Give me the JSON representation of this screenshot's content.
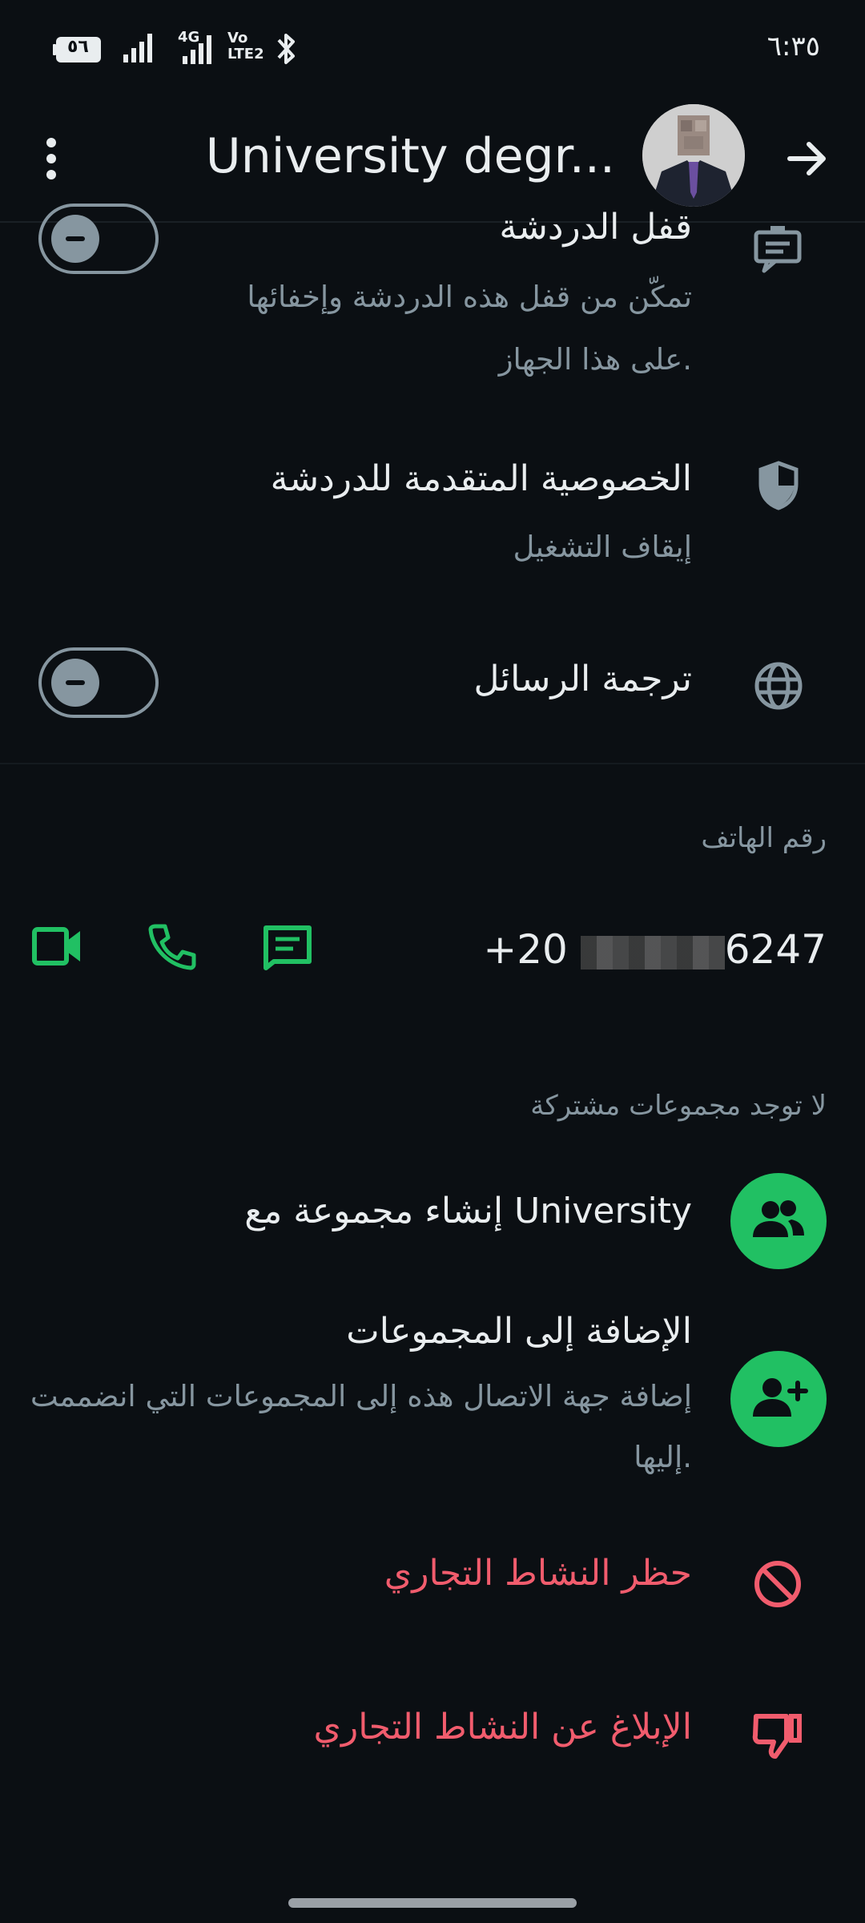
{
  "status_bar": {
    "time": "٦:٣٥",
    "battery": "٥٦",
    "network_label": "4G",
    "volte_label": "Vo LTE2"
  },
  "header": {
    "title": "University degr...",
    "more_icon": "more-vert-icon",
    "back_icon": "arrow-right-icon"
  },
  "settings": {
    "chat_lock": {
      "title": "قفل الدردشة",
      "subtitle_line1": "تمكّن من قفل هذه الدردشة وإخفائها",
      "subtitle_line2": "على هذا الجهاز.",
      "icon": "chat-lock-icon",
      "toggle_on": false
    },
    "advanced_privacy": {
      "title": "الخصوصية المتقدمة للدردشة",
      "subtitle": "إيقاف التشغيل",
      "icon": "shield-icon"
    },
    "translate": {
      "title": "ترجمة الرسائل",
      "icon": "globe-icon",
      "toggle_on": false
    }
  },
  "phone_section": {
    "label": "رقم الهاتف",
    "number_prefix": "+20",
    "number_suffix": "6247",
    "actions": [
      "video-call-icon",
      "voice-call-icon",
      "message-icon"
    ]
  },
  "groups_section": {
    "label": "لا توجد مجموعات مشتركة",
    "create_group": "إنشاء مجموعة مع University",
    "add_to_groups_title": "الإضافة إلى المجموعات",
    "add_to_groups_sub_line1": "إضافة جهة الاتصال هذه إلى المجموعات التي انضممت",
    "add_to_groups_sub_line2": "إليها."
  },
  "danger_actions": {
    "block": "حظر النشاط التجاري",
    "report": "الإبلاغ عن النشاط التجاري"
  },
  "colors": {
    "background": "#0b0f13",
    "accent_green": "#21c063",
    "danger_red": "#f15c6d",
    "secondary_text": "#8696a0"
  }
}
